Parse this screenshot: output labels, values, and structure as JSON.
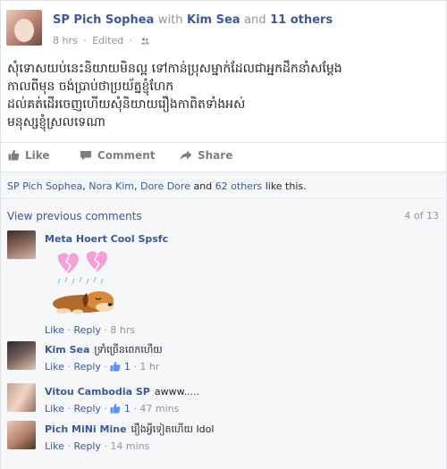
{
  "post": {
    "author": "SP Pich Sophea",
    "with_text": "with",
    "tagged": "Kim Sea",
    "and_text": "and",
    "others": "11 others",
    "time": "8 hrs",
    "edited": "Edited",
    "lines": [
      "សុំទោសយប់នេះនិយាយមិនល្អ ទៅកាន់ប្រុសម្នាក់ដែលជាអ្នកដឹកនាំសម្តែង",
      "កាលពីមុន ចង់ប្រាប់ថាប្រយ័ត្នខ្ញុំហែក",
      "ដល់គត់ដើរចេញហើយសុំនិយាយរឿងកាពិតទាំងអស់",
      "មនុស្សខ្ញុំស្រលទេណា"
    ]
  },
  "actions": {
    "like": "Like",
    "comment": "Comment",
    "share": "Share"
  },
  "likes": {
    "name1": "SP Pich Sophea",
    "name2": "Nora Kim",
    "name3": "Dore Dore",
    "and_text": "and",
    "others": "62 others",
    "suffix": "like this."
  },
  "comments_header": {
    "view_previous": "View previous comments",
    "count": "4 of 13"
  },
  "comments": [
    {
      "name": "Meta Hoert Cool Spsfc",
      "text": "",
      "like": "Like",
      "reply": "Reply",
      "likes": "",
      "time": "8 hrs"
    },
    {
      "name": "Kim Sea",
      "text": "ទ្រាំច្រើនពេកហើយ",
      "like": "Like",
      "reply": "Reply",
      "likes": "1",
      "time": "1 hr"
    },
    {
      "name": "Vitou Cambodia SP",
      "text": "awww.....",
      "like": "Like",
      "reply": "Reply",
      "likes": "1",
      "time": "47 mins"
    },
    {
      "name": "Pich MiNi Mine",
      "text": "រឿងអ្វីទៀតហើយ Idol",
      "like": "Like",
      "reply": "Reply",
      "likes": "",
      "time": "14 mins"
    }
  ],
  "separator": "·",
  "colors": {
    "link": "#3b5998",
    "muted": "#90949c",
    "panel": "#f6f7f9"
  }
}
